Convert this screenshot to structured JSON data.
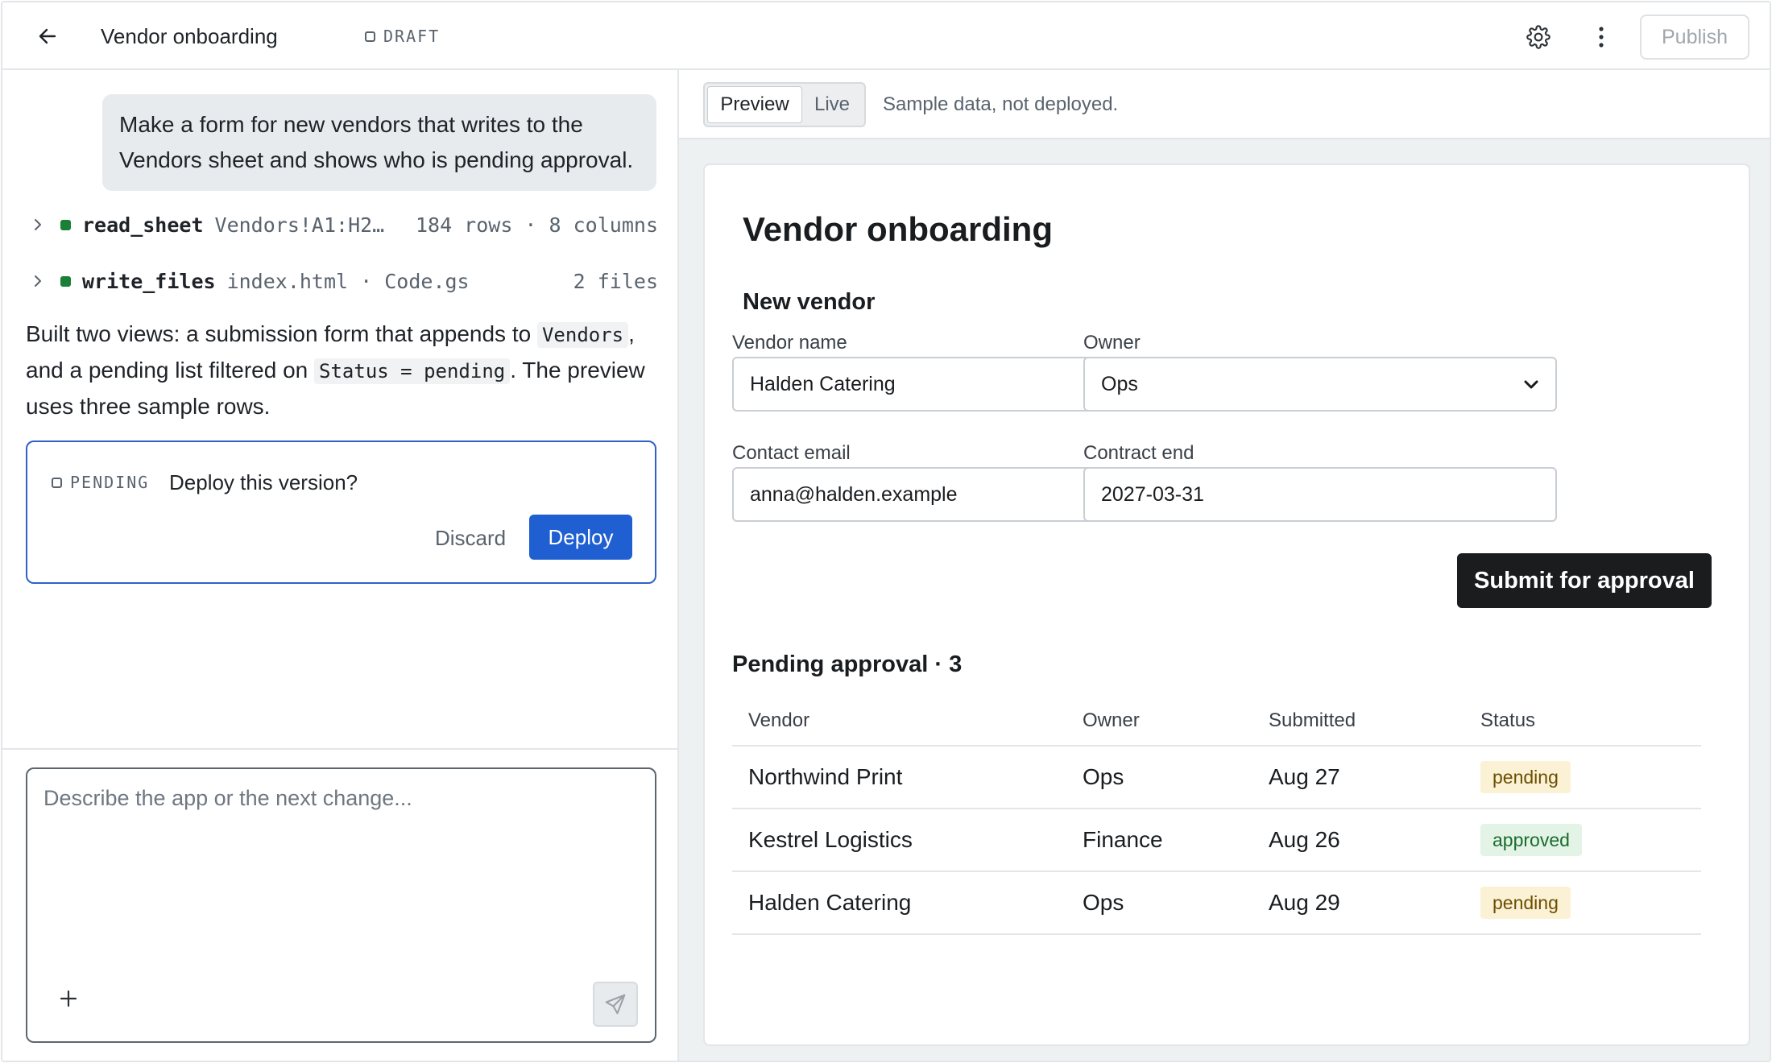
{
  "topbar": {
    "title": "Vendor onboarding",
    "status": "DRAFT",
    "publish_label": "Publish"
  },
  "chat": {
    "user_message": "Make a form for new vendors that writes to the Vendors sheet and shows who is pending approval.",
    "tools": [
      {
        "name": "read_sheet",
        "arg": "Vendors!A1:H2…",
        "meta": "184 rows · 8 columns"
      },
      {
        "name": "write_files",
        "arg": "index.html · Code.gs",
        "meta": "2 files"
      }
    ],
    "assistant": {
      "t1": "Built two views: a submission form that appends to ",
      "code1": "Vendors",
      "t2": ", and a pending list filtered on ",
      "code2": "Status = pending",
      "t3": ". The preview uses three sample rows."
    },
    "pending": {
      "tag": "PENDING",
      "question": "Deploy this version?",
      "discard_label": "Discard",
      "deploy_label": "Deploy"
    },
    "composer_placeholder": "Describe the app or the next change..."
  },
  "preview": {
    "tabs": [
      "Preview",
      "Live"
    ],
    "active_tab": "Preview",
    "note": "Sample data, not deployed.",
    "form": {
      "title": "Vendor onboarding",
      "section": "New vendor",
      "fields": {
        "vendor_name": {
          "label": "Vendor name",
          "value": "Halden Catering"
        },
        "owner": {
          "label": "Owner",
          "value": "Ops"
        },
        "contact_email": {
          "label": "Contact email",
          "value": "anna@halden.example"
        },
        "contract_end": {
          "label": "Contract end",
          "value": "2027-03-31"
        }
      },
      "submit_label": "Submit for approval"
    },
    "pending_table": {
      "title": "Pending approval · 3",
      "columns": [
        "Vendor",
        "Owner",
        "Submitted",
        "Status"
      ],
      "rows": [
        {
          "vendor": "Northwind Print",
          "owner": "Ops",
          "submitted": "Aug 27",
          "status": "pending"
        },
        {
          "vendor": "Kestrel Logistics",
          "owner": "Finance",
          "submitted": "Aug 26",
          "status": "approved"
        },
        {
          "vendor": "Halden Catering",
          "owner": "Ops",
          "submitted": "Aug 29",
          "status": "pending"
        }
      ]
    }
  },
  "colors": {
    "accent_blue": "#1f5fd1",
    "tool_ok_green": "#1a7f37",
    "pending_bg": "#fbf1d5",
    "approved_bg": "#e3f4e6"
  }
}
